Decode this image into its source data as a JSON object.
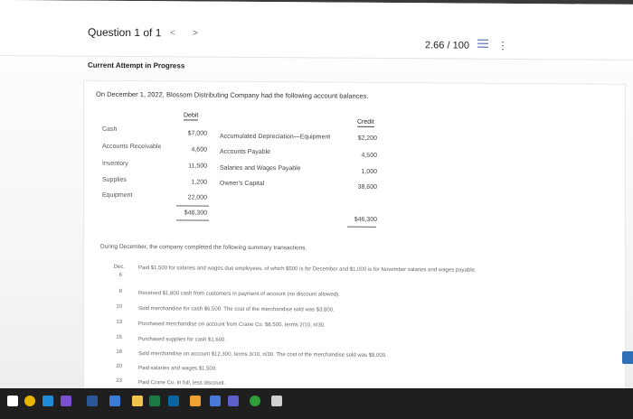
{
  "header": {
    "question_label": "Question 1 of 1",
    "prev_glyph": "<",
    "next_glyph": ">",
    "score": "2.66 / 100",
    "list_icon": "list-icon",
    "menu_icon": "kebab-menu-icon"
  },
  "attempt_label": "Current Attempt in Progress",
  "intro": "On December 1, 2022, Blossom Distributing Company had the following account balances.",
  "balances": {
    "debit_header": "Debit",
    "credit_header": "Credit",
    "debits": [
      {
        "account": "Cash",
        "amount": "$7,000"
      },
      {
        "account": "Accounts Receivable",
        "amount": "4,600"
      },
      {
        "account": "Inventory",
        "amount": "11,500"
      },
      {
        "account": "Supplies",
        "amount": "1,200"
      },
      {
        "account": "Equipment",
        "amount": "22,000"
      }
    ],
    "debit_total": "$46,300",
    "credits": [
      {
        "account": "Accumulated Depreciation—Equipment",
        "amount": "$2,200"
      },
      {
        "account": "Accounts Payable",
        "amount": "4,500"
      },
      {
        "account": "Salaries and Wages Payable",
        "amount": "1,000"
      },
      {
        "account": "Owner's Capital",
        "amount": "38,600"
      }
    ],
    "credit_total": "$46,300"
  },
  "summary_intro": "During December, the company completed the following summary transactions.",
  "transactions": {
    "month": "Dec.",
    "items": [
      {
        "day": "6",
        "text": "Paid $1,500 for salaries and wages due employees, of which $500 is for December and $1,000 is for November salaries and wages payable."
      },
      {
        "day": "8",
        "text": "Received $1,800 cash from customers in payment of account (no discount allowed)."
      },
      {
        "day": "10",
        "text": "Sold merchandise for cash $6,500. The cost of the merchandise sold was $3,800."
      },
      {
        "day": "13",
        "text": "Purchased merchandise on account from Crane Co. $8,500, terms 2/10, n/30."
      },
      {
        "day": "15",
        "text": "Purchased supplies for cash $1,600."
      },
      {
        "day": "18",
        "text": "Sold merchandise on account $12,300, terms 3/10, n/30. The cost of the merchandise sold was $8,000."
      },
      {
        "day": "20",
        "text": "Paid salaries and wages $1,500."
      },
      {
        "day": "23",
        "text": "Paid Crane Co. in full, less discount."
      }
    ]
  },
  "taskbar": {
    "icons": [
      "start-icon",
      "chrome-icon",
      "search-icon",
      "media-icon",
      "word-icon",
      "app-icon",
      "folder-icon",
      "excel-icon",
      "mail-icon",
      "explorer-icon",
      "store-icon",
      "teams-icon",
      "xbox-icon",
      "pen-icon"
    ],
    "colors": [
      "#ffffff",
      "#e8b400",
      "#1f8ad8",
      "#7a4fd0",
      "#2b5797",
      "#3a7bd5",
      "#f2c14e",
      "#1d7a45",
      "#0a64a0",
      "#f0a030",
      "#4a7ad9",
      "#5b5fc7",
      "#2f9e3a",
      "#d0d0d0"
    ]
  },
  "colors": {
    "accent": "#2f6fb7"
  }
}
